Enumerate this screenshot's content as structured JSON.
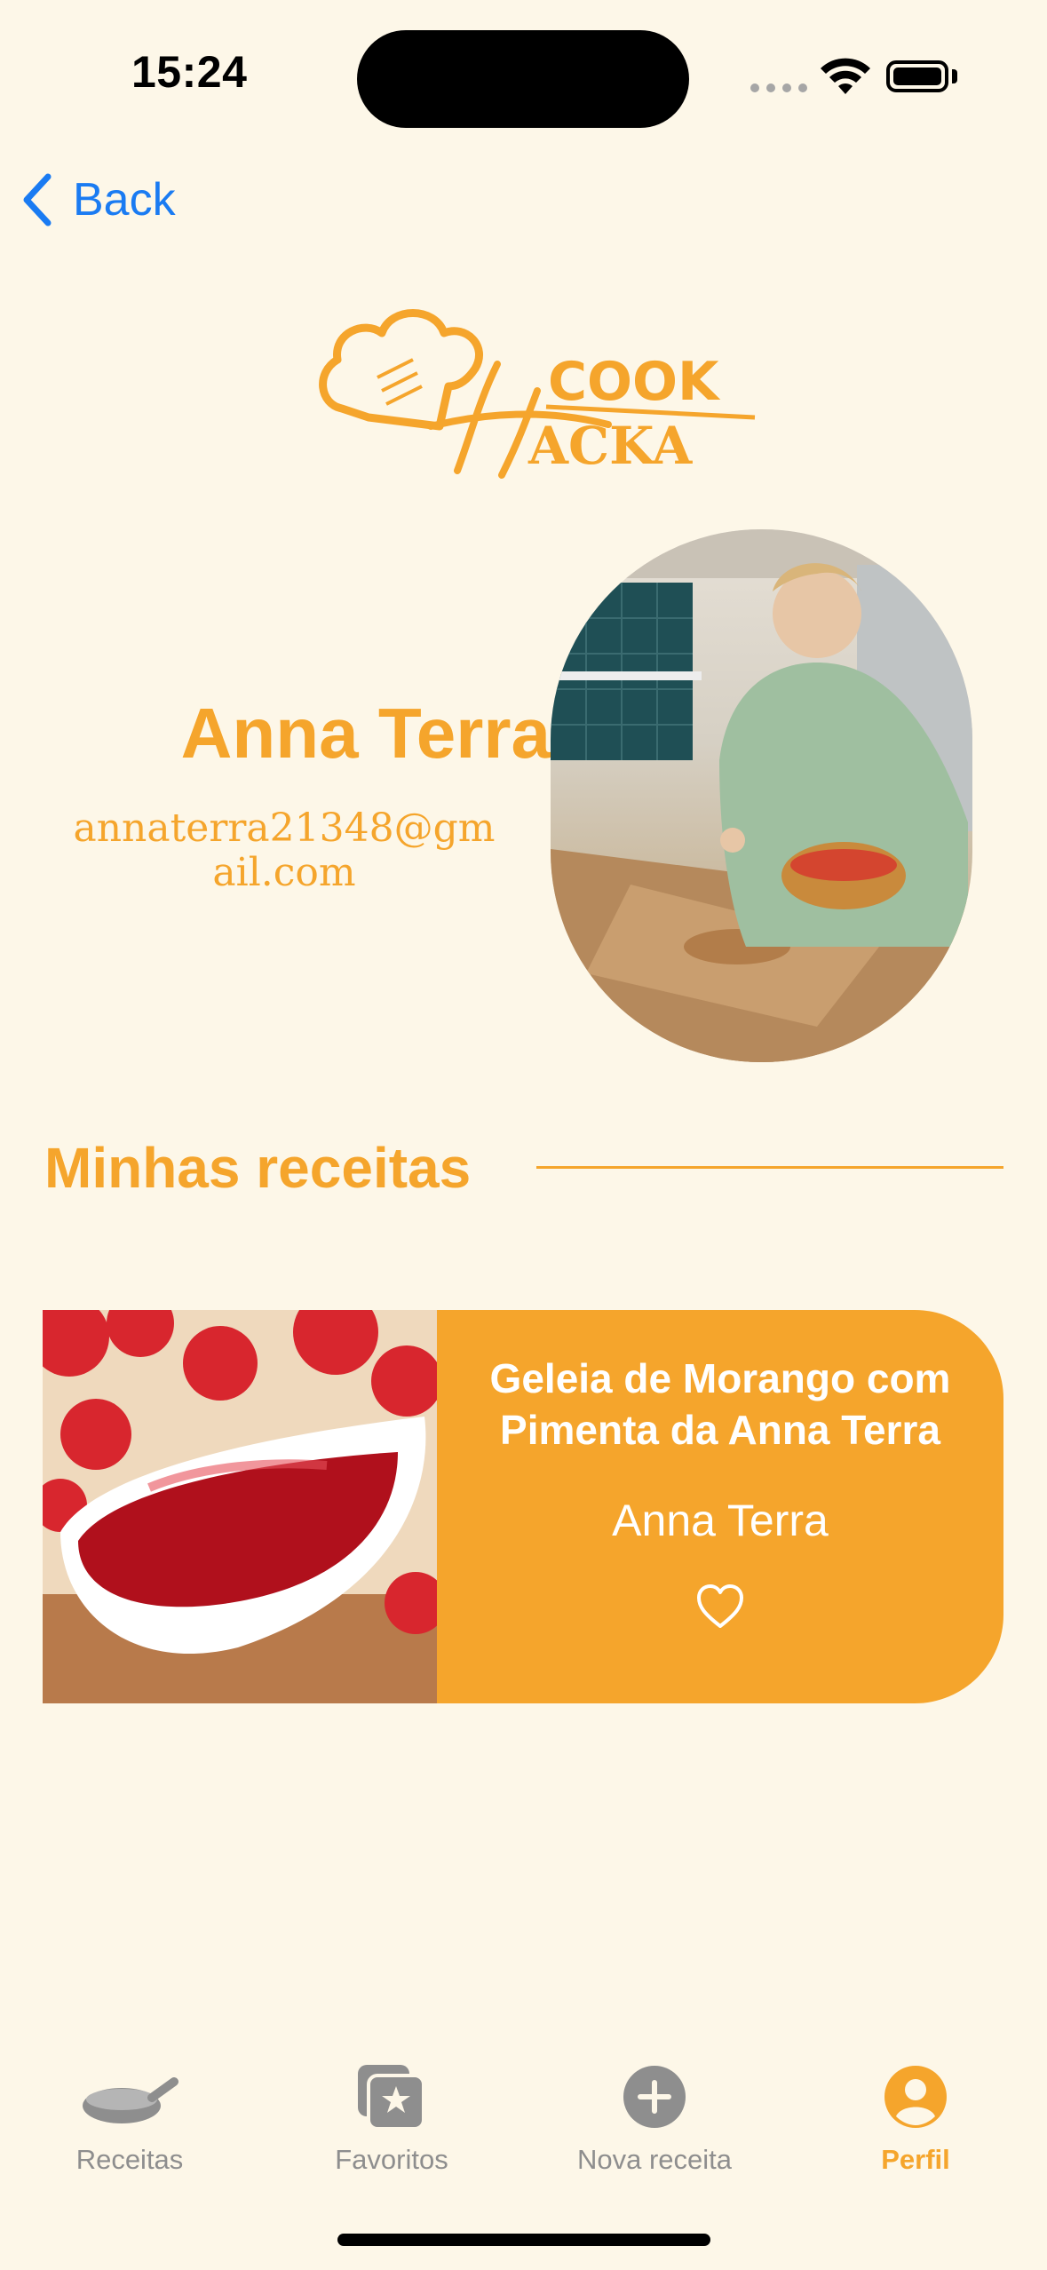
{
  "status_bar": {
    "time": "15:24"
  },
  "nav": {
    "back_label": "Back"
  },
  "logo": {
    "text_top": "COOK",
    "text_bottom": "ACKA",
    "initial": "H"
  },
  "profile": {
    "name": "Anna Terra",
    "email": "annaterra21348@gmail.com"
  },
  "section": {
    "title": "Minhas receitas"
  },
  "recipes": [
    {
      "title": "Geleia de Morango com Pimenta da Anna Terra",
      "author": "Anna Terra",
      "favorited": false
    }
  ],
  "tab_bar": {
    "items": [
      {
        "label": "Receitas",
        "icon": "pan-icon",
        "active": false
      },
      {
        "label": "Favoritos",
        "icon": "star-folder-icon",
        "active": false
      },
      {
        "label": "Nova receita",
        "icon": "plus-circle-icon",
        "active": false
      },
      {
        "label": "Perfil",
        "icon": "person-circle-icon",
        "active": true
      }
    ]
  },
  "colors": {
    "background": "#FDF7E8",
    "accent": "#F5A52C",
    "link": "#1A7BF2",
    "inactive": "#8E8E8E"
  }
}
